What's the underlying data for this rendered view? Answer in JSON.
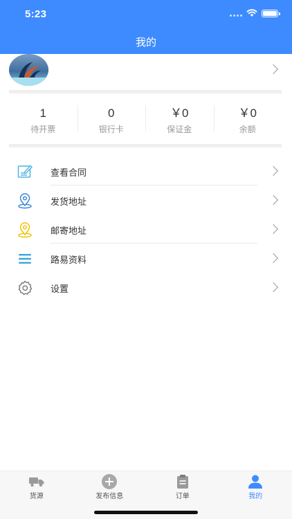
{
  "status_bar": {
    "time": "5:23"
  },
  "header": {
    "title": "我的"
  },
  "stats": [
    {
      "value": "1",
      "label": "待开票"
    },
    {
      "value": "0",
      "label": "银行卡"
    },
    {
      "value": "￥0",
      "label": "保证金"
    },
    {
      "value": "￥0",
      "label": "余额"
    }
  ],
  "menu": [
    {
      "label": "查看合同",
      "icon": "contract-icon"
    },
    {
      "label": "发货地址",
      "icon": "location-pin-icon"
    },
    {
      "label": "邮寄地址",
      "icon": "location-pin-icon"
    },
    {
      "label": "路易资料",
      "icon": "list-icon"
    },
    {
      "label": "设置",
      "icon": "gear-icon"
    }
  ],
  "tabbar": [
    {
      "label": "货源",
      "icon": "truck-icon",
      "active": false
    },
    {
      "label": "发布信息",
      "icon": "plus-circle-icon",
      "active": false
    },
    {
      "label": "订单",
      "icon": "clipboard-icon",
      "active": false
    },
    {
      "label": "我的",
      "icon": "user-icon",
      "active": true
    }
  ],
  "colors": {
    "accent": "#3d8bff",
    "pin_blue": "#3a86d6",
    "pin_yellow": "#f2c200",
    "contract": "#4fb3e6"
  }
}
